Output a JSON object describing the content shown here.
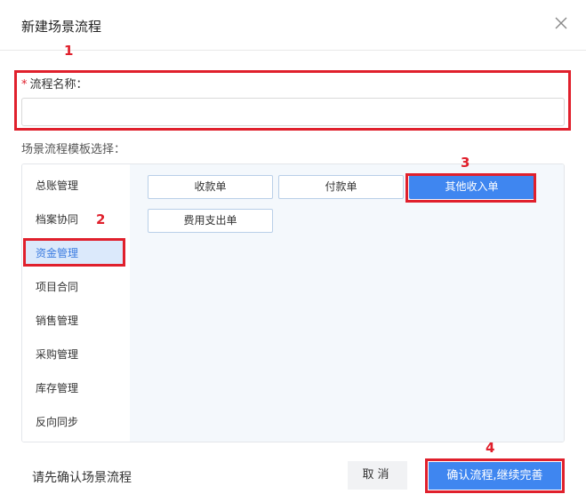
{
  "dialog": {
    "title": "新建场景流程"
  },
  "form": {
    "name_label": "流程名称：",
    "required_mark": "*",
    "name_value": "",
    "template_label": "场景流程模板选择："
  },
  "sidebar": {
    "items": [
      {
        "label": "总账管理",
        "active": false
      },
      {
        "label": "档案协同",
        "active": false
      },
      {
        "label": "资金管理",
        "active": true
      },
      {
        "label": "项目合同",
        "active": false
      },
      {
        "label": "销售管理",
        "active": false
      },
      {
        "label": "采购管理",
        "active": false
      },
      {
        "label": "库存管理",
        "active": false
      },
      {
        "label": "反向同步",
        "active": false
      }
    ]
  },
  "templates": [
    {
      "label": "收款单",
      "selected": false
    },
    {
      "label": "付款单",
      "selected": false
    },
    {
      "label": "其他收入单",
      "selected": true
    },
    {
      "label": "费用支出单",
      "selected": false
    }
  ],
  "annotations": [
    "1",
    "2",
    "3",
    "4"
  ],
  "footer": {
    "hint": "请先确认场景流程",
    "cancel_label": "取消",
    "confirm_label": "确认流程,继续完善"
  },
  "colors": {
    "accent": "#3f86f0",
    "annotation_red": "#e0202c",
    "active_bg": "#dbe9fb"
  }
}
